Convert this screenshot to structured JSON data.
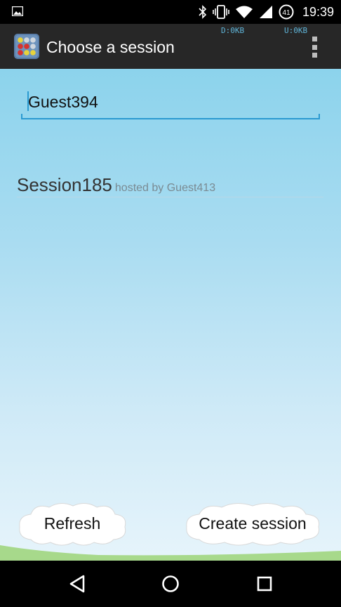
{
  "status_bar": {
    "time": "19:39",
    "battery_level": "41",
    "icons": [
      "image-notification-icon",
      "bluetooth-icon",
      "vibrate-icon",
      "wifi-icon",
      "signal-icon",
      "battery-icon"
    ]
  },
  "action_bar": {
    "title": "Choose a session",
    "download_traffic": "D:0KB",
    "upload_traffic": "U:0KB",
    "icons": [
      "app-icon",
      "overflow-menu-icon"
    ]
  },
  "player_name": {
    "value": "Guest394"
  },
  "sessions": [
    {
      "name": "Session185",
      "host_text": "hosted by Guest413"
    }
  ],
  "buttons": {
    "refresh_label": "Refresh",
    "create_label": "Create session"
  },
  "nav_bar": {
    "icons": [
      "back-icon",
      "home-icon",
      "recents-icon"
    ]
  },
  "colors": {
    "accent": "#2b9ad1",
    "sky_top": "#8cd3ec",
    "sky_bottom": "#e6f4fb",
    "grass": "#a7d98b",
    "action_bar": "#272727"
  }
}
